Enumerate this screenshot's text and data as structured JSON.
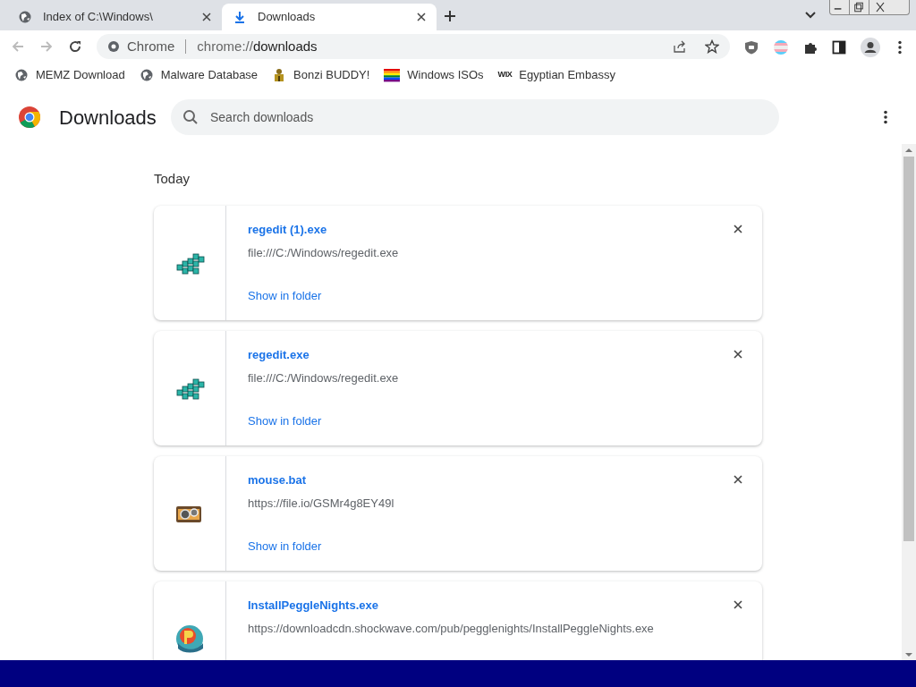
{
  "tabs": [
    {
      "title": "Index of C:\\Windows\\",
      "selected": false,
      "kind": "globe"
    },
    {
      "title": "Downloads",
      "selected": true,
      "kind": "download"
    }
  ],
  "address": {
    "site": "Chrome",
    "url_prefix": "chrome://",
    "url_path": "downloads"
  },
  "bookmarks": [
    {
      "label": "MEMZ Download",
      "kind": "globe"
    },
    {
      "label": "Malware Database",
      "kind": "globe"
    },
    {
      "label": "Bonzi BUDDY!",
      "kind": "figure"
    },
    {
      "label": "Windows ISOs",
      "kind": "rainbow"
    },
    {
      "label": "Egyptian Embassy",
      "kind": "wix"
    }
  ],
  "bookmark_wix_mark": "WIX",
  "page": {
    "title": "Downloads",
    "search": {
      "placeholder": "Search downloads"
    }
  },
  "section": "Today",
  "downloads": [
    {
      "name": "regedit (1).exe",
      "source": "file:///C:/Windows/regedit.exe",
      "link": "Show in folder",
      "kind": "cubes"
    },
    {
      "name": "regedit.exe",
      "source": "file:///C:/Windows/regedit.exe",
      "link": "Show in folder",
      "kind": "cubes"
    },
    {
      "name": "mouse.bat",
      "source": "https://file.io/GSMr4g8EY49l",
      "link": "Show in folder",
      "kind": "gears"
    },
    {
      "name": "InstallPeggleNights.exe",
      "source": "https://downloadcdn.shockwave.com/pub/pegglenights/InstallPeggleNights.exe",
      "kind": "ball"
    }
  ]
}
